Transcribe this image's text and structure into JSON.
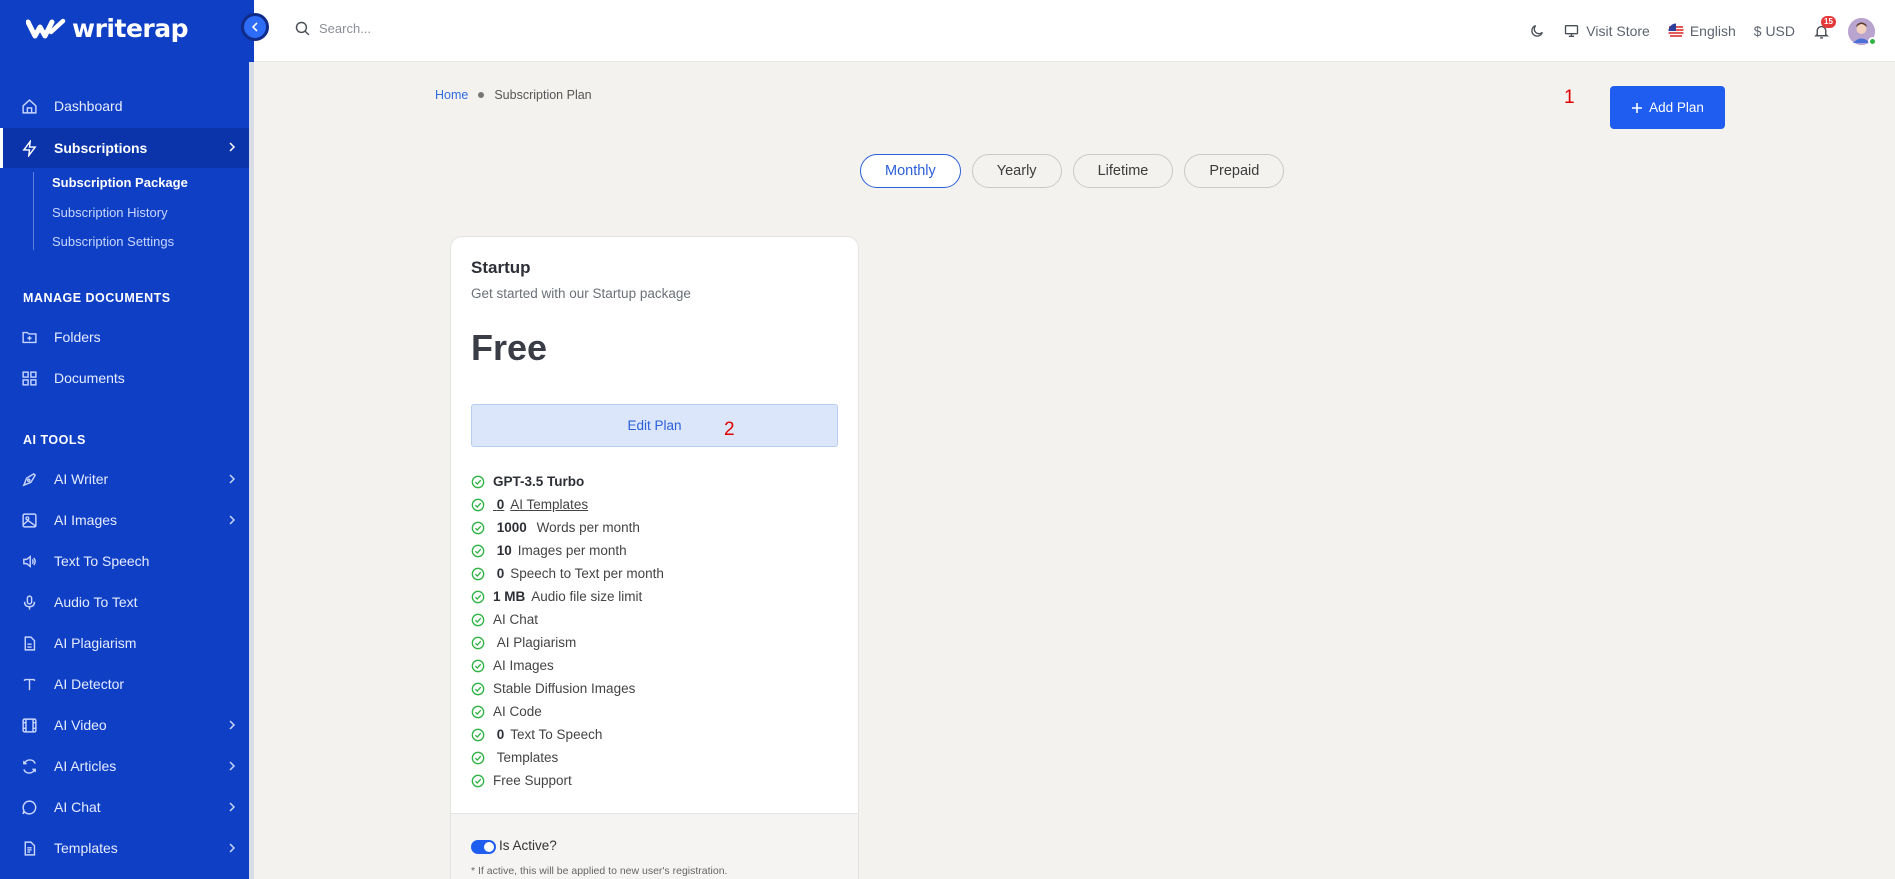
{
  "brand": {
    "name": "writerap"
  },
  "search": {
    "placeholder": "Search..."
  },
  "topbar": {
    "visit_store": "Visit Store",
    "language": "English",
    "currency": "$ USD",
    "notification_count": "15"
  },
  "sidebar": {
    "items": [
      {
        "label": "Dashboard",
        "icon": "home-icon"
      },
      {
        "label": "Subscriptions",
        "icon": "lightning-icon"
      },
      {
        "label": "Folders",
        "icon": "folder-icon"
      },
      {
        "label": "Documents",
        "icon": "grid-icon"
      },
      {
        "label": "AI Writer",
        "icon": "pen-icon"
      },
      {
        "label": "AI Images",
        "icon": "image-icon"
      },
      {
        "label": "Text To Speech",
        "icon": "speaker-icon"
      },
      {
        "label": "Audio To Text",
        "icon": "microphone-icon"
      },
      {
        "label": "AI Plagiarism",
        "icon": "file-icon"
      },
      {
        "label": "AI Detector",
        "icon": "text-icon"
      },
      {
        "label": "AI Video",
        "icon": "film-icon"
      },
      {
        "label": "AI Articles",
        "icon": "refresh-icon"
      },
      {
        "label": "AI Chat",
        "icon": "chat-icon"
      },
      {
        "label": "Templates",
        "icon": "document-icon"
      }
    ],
    "subscription_subitems": [
      "Subscription Package",
      "Subscription History",
      "Subscription Settings"
    ],
    "sections": [
      "MANAGE DOCUMENTS",
      "AI TOOLS"
    ]
  },
  "breadcrumb": {
    "home": "Home",
    "current": "Subscription Plan"
  },
  "annotations": [
    "1",
    "2"
  ],
  "add_plan_label": "Add Plan",
  "tabs": [
    "Monthly",
    "Yearly",
    "Lifetime",
    "Prepaid"
  ],
  "active_tab": "Monthly",
  "plan": {
    "title": "Startup",
    "subtitle": "Get started with our Startup package",
    "price": "Free",
    "edit_label": "Edit Plan",
    "features": {
      "f1": "GPT-3.5 Turbo",
      "f2_num": "0",
      "f2_text": "AI Templates",
      "f3_num": "1000",
      "f3_text": "Words per month",
      "f4_num": "10",
      "f4_text": "Images per month",
      "f5_num": "0",
      "f5_text": "Speech to Text per month",
      "f6_num": "1 MB",
      "f6_text": "Audio file size limit",
      "f7": "AI Chat",
      "f8": "AI Plagiarism",
      "f9": "AI Images",
      "f10": "Stable Diffusion Images",
      "f11": "AI Code",
      "f12_num": "0",
      "f12_text": "Text To Speech",
      "f13": "Templates",
      "f14": "Free Support"
    },
    "is_active_label": "Is Active?",
    "is_active": true,
    "active_note": "* If active, this will be applied to new user's registration."
  },
  "colors": {
    "sidebar": "#0f3fc4",
    "accent": "#1f5cf0",
    "check": "#2fb344",
    "annotation": "#e00000"
  }
}
